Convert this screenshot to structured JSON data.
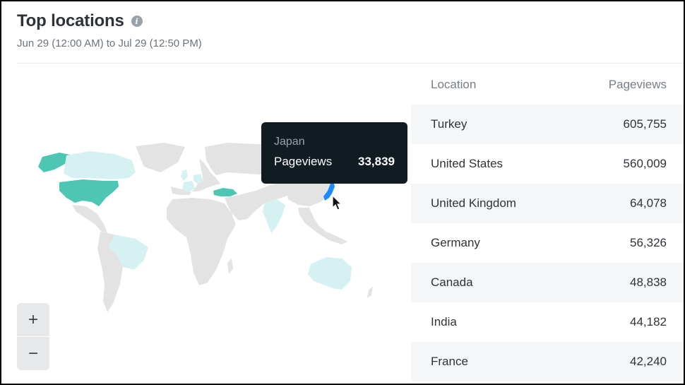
{
  "panel": {
    "title": "Top locations",
    "info_icon": "info-icon",
    "date_range": "Jun 29 (12:00 AM) to Jul 29 (12:50 PM)"
  },
  "map": {
    "colors": {
      "land": "#e3e3e3",
      "high": "#4dc6b4",
      "low": "#d6f1f2",
      "hover": "#1a8cff"
    },
    "highlighted_countries": [
      "Turkey",
      "United States",
      "United Kingdom",
      "Germany",
      "Canada",
      "India",
      "France",
      "Japan"
    ]
  },
  "zoom": {
    "zoom_in_label": "+",
    "zoom_out_label": "−"
  },
  "tooltip": {
    "country": "Japan",
    "metric_label": "Pageviews",
    "metric_value": "33,839"
  },
  "table": {
    "headers": {
      "location": "Location",
      "pageviews": "Pageviews"
    },
    "rows": [
      {
        "location": "Turkey",
        "pageviews": "605,755"
      },
      {
        "location": "United States",
        "pageviews": "560,009"
      },
      {
        "location": "United Kingdom",
        "pageviews": "64,078"
      },
      {
        "location": "Germany",
        "pageviews": "56,326"
      },
      {
        "location": "Canada",
        "pageviews": "48,838"
      },
      {
        "location": "India",
        "pageviews": "44,182"
      },
      {
        "location": "France",
        "pageviews": "42,240"
      }
    ]
  }
}
